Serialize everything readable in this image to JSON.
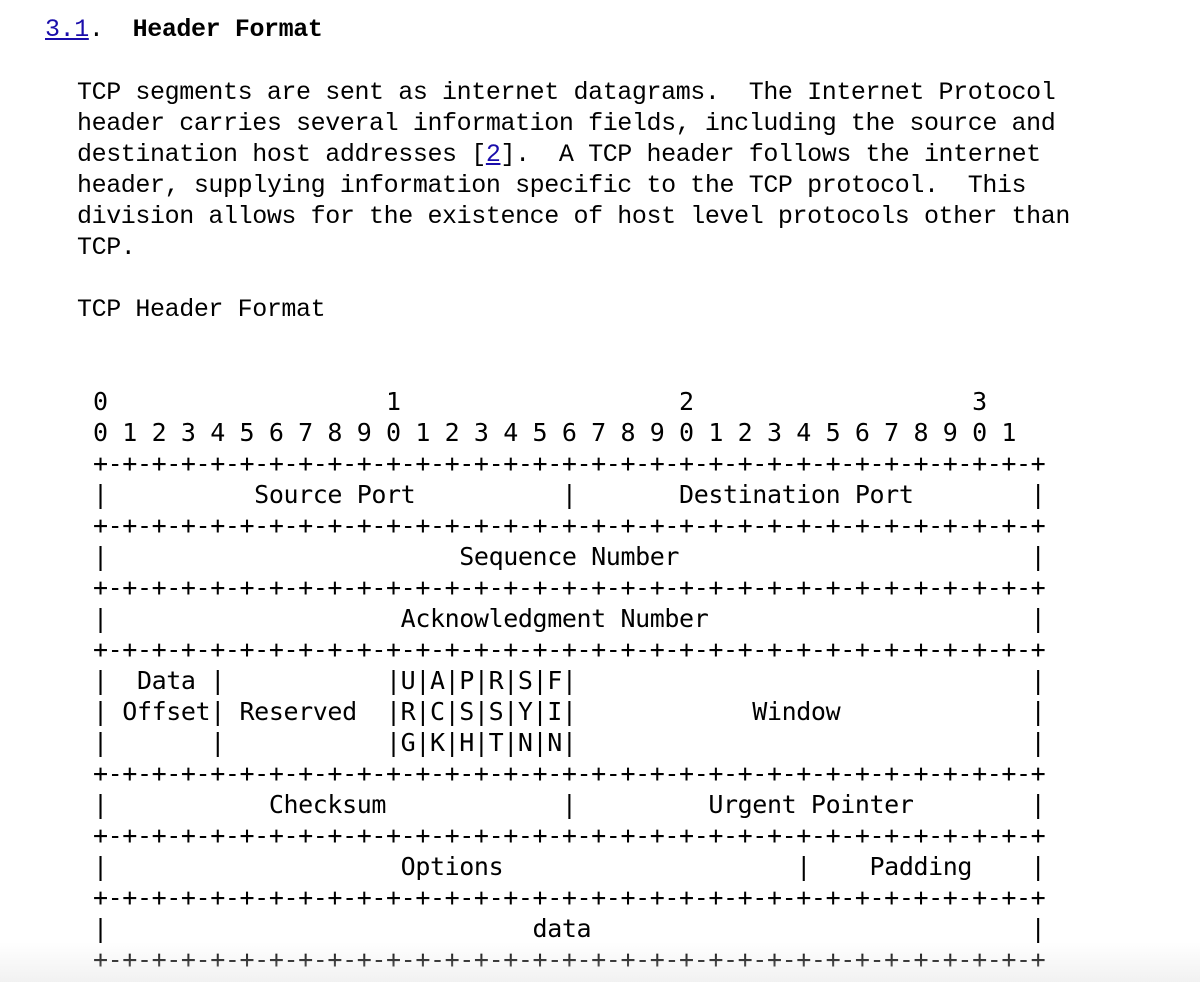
{
  "section": {
    "number": "3.1",
    "after_number": ".  ",
    "title": "Header Format"
  },
  "paragraph": {
    "before_ref": "TCP segments are sent as internet datagrams.  The Internet Protocol\nheader carries several information fields, including the source and\ndestination host addresses [",
    "ref": "2",
    "after_ref": "].  A TCP header follows the internet\nheader, supplying information specific to the TCP protocol.  This\ndivision allows for the existence of host level protocols other than\nTCP."
  },
  "diagram_title": "TCP Header Format",
  "diagram_lines": [
    "0                   1                   2                   3",
    "0 1 2 3 4 5 6 7 8 9 0 1 2 3 4 5 6 7 8 9 0 1 2 3 4 5 6 7 8 9 0 1",
    "+-+-+-+-+-+-+-+-+-+-+-+-+-+-+-+-+-+-+-+-+-+-+-+-+-+-+-+-+-+-+-+-+",
    "|          Source Port          |       Destination Port        |",
    "+-+-+-+-+-+-+-+-+-+-+-+-+-+-+-+-+-+-+-+-+-+-+-+-+-+-+-+-+-+-+-+-+",
    "|                        Sequence Number                        |",
    "+-+-+-+-+-+-+-+-+-+-+-+-+-+-+-+-+-+-+-+-+-+-+-+-+-+-+-+-+-+-+-+-+",
    "|                    Acknowledgment Number                      |",
    "+-+-+-+-+-+-+-+-+-+-+-+-+-+-+-+-+-+-+-+-+-+-+-+-+-+-+-+-+-+-+-+-+",
    "|  Data |           |U|A|P|R|S|F|                               |",
    "| Offset| Reserved  |R|C|S|S|Y|I|            Window             |",
    "|       |           |G|K|H|T|N|N|                               |",
    "+-+-+-+-+-+-+-+-+-+-+-+-+-+-+-+-+-+-+-+-+-+-+-+-+-+-+-+-+-+-+-+-+",
    "|           Checksum            |         Urgent Pointer        |",
    "+-+-+-+-+-+-+-+-+-+-+-+-+-+-+-+-+-+-+-+-+-+-+-+-+-+-+-+-+-+-+-+-+",
    "|                    Options                    |    Padding    |",
    "+-+-+-+-+-+-+-+-+-+-+-+-+-+-+-+-+-+-+-+-+-+-+-+-+-+-+-+-+-+-+-+-+",
    "|                             data                              |",
    "+-+-+-+-+-+-+-+-+-+-+-+-+-+-+-+-+-+-+-+-+-+-+-+-+-+-+-+-+-+-+-+-+"
  ]
}
